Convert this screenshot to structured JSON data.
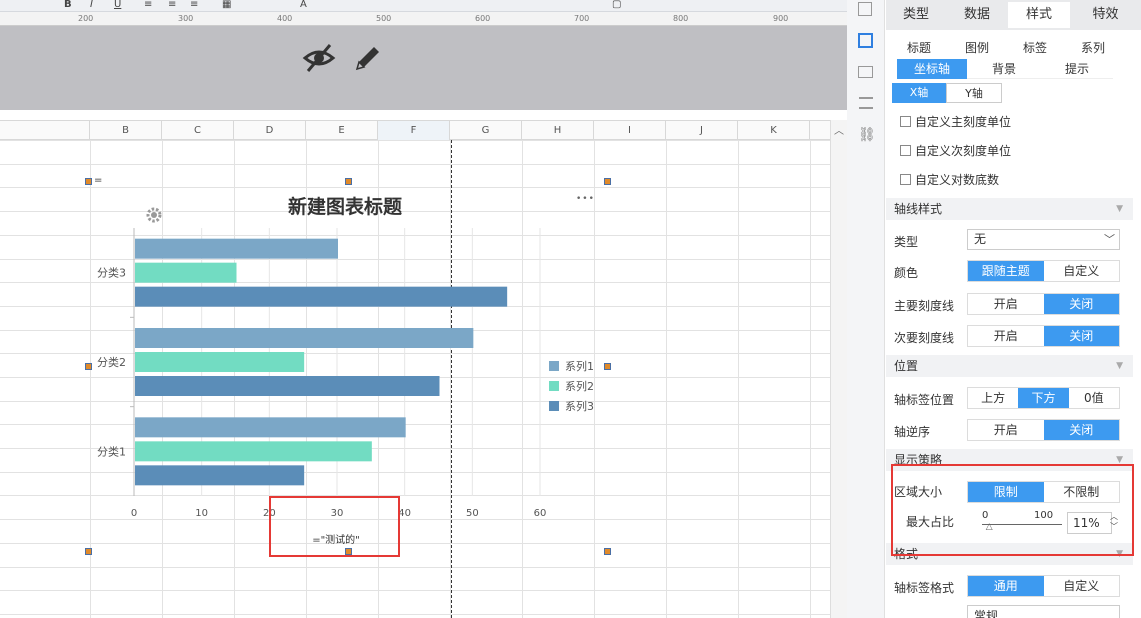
{
  "ruler": {
    "ticks": [
      "200",
      "300",
      "400",
      "500",
      "600",
      "700",
      "800",
      "900"
    ]
  },
  "columns": [
    "B",
    "C",
    "D",
    "E",
    "F",
    "G",
    "H",
    "I",
    "J",
    "K"
  ],
  "chart": {
    "title": "新建图表标题",
    "formula_cell": "=",
    "formula_label": "=\"测试的\"",
    "more": "•••"
  },
  "chart_data": {
    "type": "bar",
    "orientation": "horizontal",
    "categories": [
      "分类3",
      "分类2",
      "分类1"
    ],
    "series": [
      {
        "name": "系列1",
        "values": [
          30,
          50,
          40
        ],
        "color": "#7ba7c7"
      },
      {
        "name": "系列2",
        "values": [
          15,
          25,
          35
        ],
        "color": "#72dcc2"
      },
      {
        "name": "系列3",
        "values": [
          55,
          45,
          25
        ],
        "color": "#5b8db8"
      }
    ],
    "xticks": [
      "0",
      "10",
      "20",
      "30",
      "40",
      "50",
      "60"
    ],
    "xlim": [
      0,
      60
    ],
    "legend": "right"
  },
  "panel": {
    "tabs": [
      "类型",
      "数据",
      "样式",
      "特效"
    ],
    "active_tab": "样式",
    "subtabs1": [
      "标题",
      "图例",
      "标签",
      "系列"
    ],
    "subtabs2": [
      "坐标轴",
      "背景",
      "提示"
    ],
    "axis_tabs": [
      "X轴",
      "Y轴"
    ],
    "checks": [
      "自定义主刻度单位",
      "自定义次刻度单位",
      "自定义对数底数"
    ],
    "sec_axisline": "轴线样式",
    "type_label": "类型",
    "type_value": "无",
    "color_label": "颜色",
    "color_opts": [
      "跟随主题",
      "自定义"
    ],
    "major_label": "主要刻度线",
    "minor_label": "次要刻度线",
    "onoff": [
      "开启",
      "关闭"
    ],
    "sec_position": "位置",
    "labelpos_label": "轴标签位置",
    "labelpos_opts": [
      "上方",
      "下方",
      "0值"
    ],
    "reverse_label": "轴逆序",
    "sec_display": "显示策略",
    "area_label": "区域大小",
    "area_opts": [
      "限制",
      "不限制"
    ],
    "maxratio_label": "最大占比",
    "slider_min": "0",
    "slider_max": "100",
    "slider_value": "11%",
    "slider_fraction": 0.11,
    "sec_format": "格式",
    "labelfmt_label": "轴标签格式",
    "labelfmt_opts": [
      "通用",
      "自定义"
    ],
    "bottom_select": "常规"
  }
}
